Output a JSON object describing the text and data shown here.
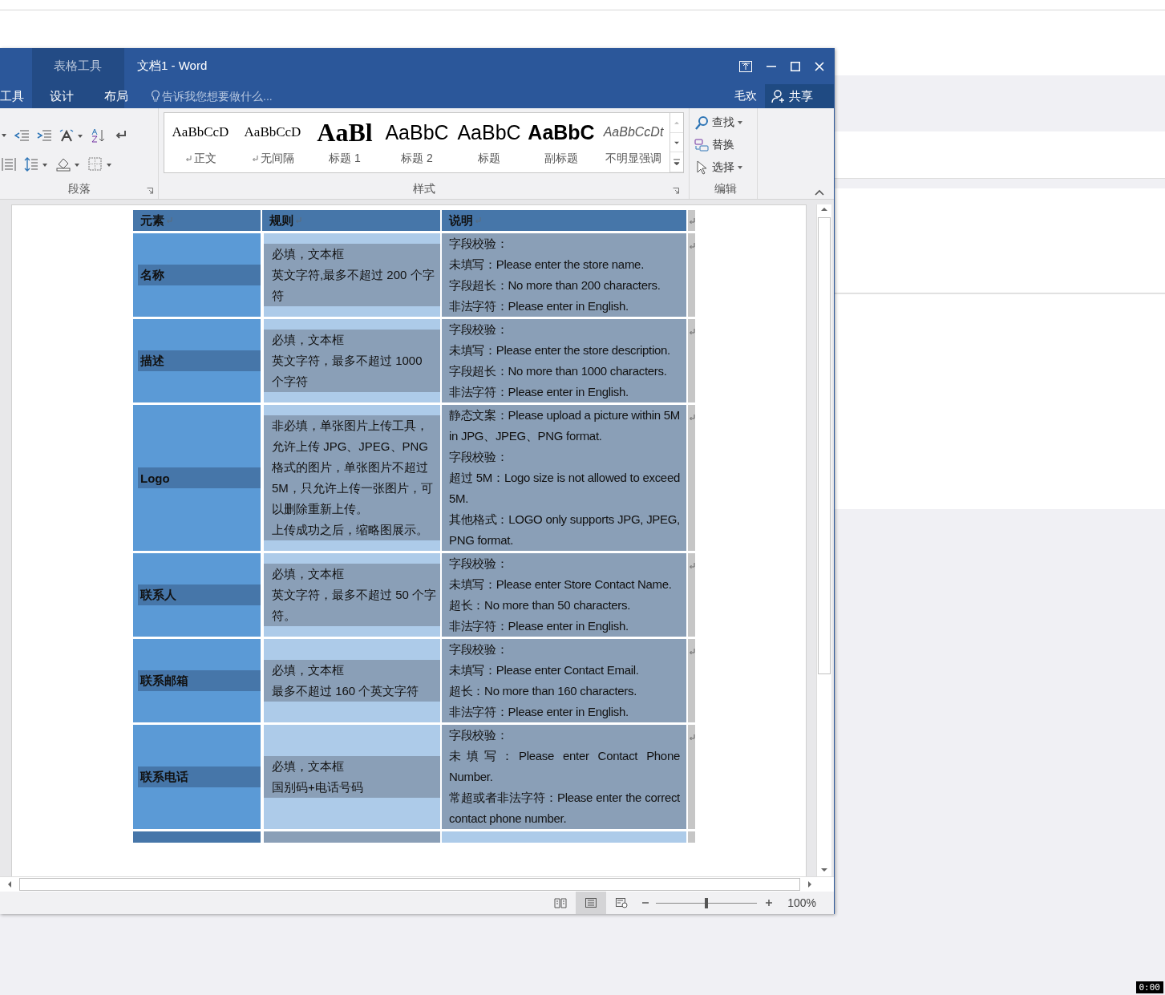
{
  "window": {
    "title": "文档1 - Word",
    "context_label": "表格工具"
  },
  "ribbon_tabs": [
    {
      "label": "工具",
      "context": false,
      "selected": false
    },
    {
      "label": "设计",
      "context": true,
      "selected": false
    },
    {
      "label": "布局",
      "context": true,
      "selected": false
    }
  ],
  "tell_me": {
    "placeholder": "告诉我您想要做什么..."
  },
  "user": "毛欢",
  "share": "共享",
  "groups": {
    "paragraph": "段落",
    "styles": "样式",
    "editing": "编辑"
  },
  "styles": [
    {
      "preview": "AaBbCcD",
      "name": "正文",
      "kind": "normal",
      "paragraph_mark": true
    },
    {
      "preview": "AaBbCcD",
      "name": "无间隔",
      "kind": "nospacing",
      "paragraph_mark": true
    },
    {
      "preview": "AaBl",
      "name": "标题 1",
      "kind": "heading1",
      "paragraph_mark": false
    },
    {
      "preview": "AaBbC",
      "name": "标题 2",
      "kind": "heading2",
      "paragraph_mark": false
    },
    {
      "preview": "AaBbC",
      "name": "标题",
      "kind": "title",
      "paragraph_mark": false
    },
    {
      "preview": "AaBbC",
      "name": "副标题",
      "kind": "subtitle",
      "paragraph_mark": false
    },
    {
      "preview": "AaBbCcDt",
      "name": "不明显强调",
      "kind": "emphasis",
      "paragraph_mark": false
    }
  ],
  "editing": [
    {
      "label": "查找",
      "kind": "find",
      "dropdown": true
    },
    {
      "label": "替换",
      "kind": "replace",
      "dropdown": false
    },
    {
      "label": "选择",
      "kind": "select",
      "dropdown": true
    }
  ],
  "table": {
    "columns": [
      "元素",
      "规则",
      "说明"
    ],
    "rows": [
      {
        "element": "名称",
        "rules": [
          "必填，文本框",
          "英文字符,最多不超过 200 个字符"
        ],
        "notes": [
          "字段校验：",
          "未填写：Please enter the store name.",
          "字段超长：No more than 200 characters.",
          "非法字符：Please enter in English."
        ]
      },
      {
        "element": "描述",
        "rules": [
          "必填，文本框",
          "英文字符，最多不超过 1000 个字符"
        ],
        "notes": [
          "字段校验：",
          "未填写：Please enter the store description.",
          "字段超长：No more than 1000 characters.",
          "非法字符：Please enter in English."
        ]
      },
      {
        "element": "Logo",
        "rules": [
          "非必填，单张图片上传工具，允许上传 JPG、JPEG、PNG 格式的图片，单张图片不超过 5M，只允许上传一张图片，可以删除重新上传。",
          "上传成功之后，缩略图展示。"
        ],
        "notes": [
          "静态文案：Please upload a picture within 5M in JPG、JPEG、PNG format.",
          "字段校验：",
          "超过 5M：Logo size is not allowed to exceed 5M.",
          "其他格式：LOGO only supports JPG, JPEG, PNG format."
        ]
      },
      {
        "element": "联系人",
        "rules": [
          "必填，文本框",
          "英文字符，最多不超过 50 个字符。"
        ],
        "notes": [
          "字段校验：",
          "未填写：Please enter Store Contact Name.",
          "超长：No more than 50 characters.",
          "非法字符：Please enter in English."
        ]
      },
      {
        "element": "联系邮箱",
        "rules": [
          "必填，文本框",
          "最多不超过 160 个英文字符"
        ],
        "notes": [
          "字段校验：",
          "未填写：Please enter Contact Email.",
          "超长：No more than 160 characters.",
          "非法字符：Please enter in English."
        ]
      },
      {
        "element": "联系电话",
        "rules": [
          "必填，文本框",
          "国别码+电话号码"
        ],
        "notes": [
          "字段校验：",
          "未填写：Please enter Contact Phone Number.",
          "常超或者非法字符：Please enter the correct contact phone number."
        ]
      }
    ]
  },
  "status_bar": {
    "views": [
      {
        "kind": "read",
        "selected": false
      },
      {
        "kind": "print",
        "selected": true
      },
      {
        "kind": "web",
        "selected": false
      }
    ],
    "zoom": {
      "level": 0.5,
      "reading": "100%"
    }
  },
  "recorder_time": "0:00"
}
